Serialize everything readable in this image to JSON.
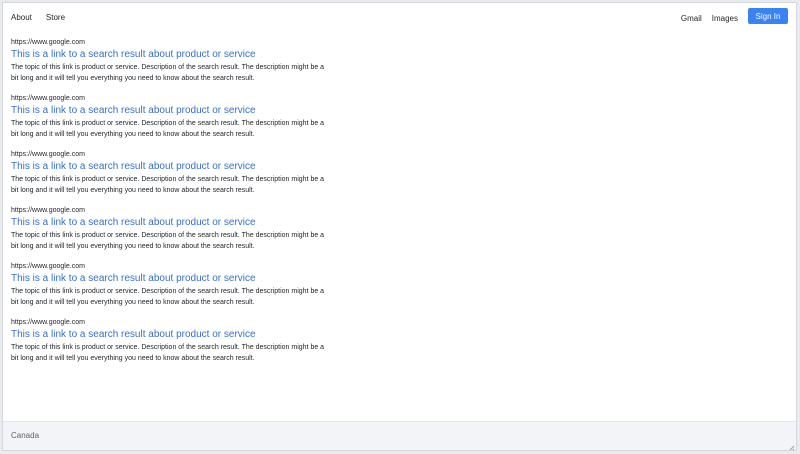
{
  "nav": {
    "left": [
      {
        "label": "About"
      },
      {
        "label": "Store"
      }
    ],
    "right": {
      "gmail": "Gmail",
      "images": "Images",
      "signin": "Sign In"
    }
  },
  "results": [
    {
      "url": "https://www.google.com",
      "title": "This is a link to a search result about product or service",
      "description": "The topic of this link is product or service. Description of the search result. The description might be a bit long and it will tell you everything you need to know about the search result."
    },
    {
      "url": "https://www.google.com",
      "title": "This is a link to a search result about product or service",
      "description": "The topic of this link is product or service. Description of the search result. The description might be a bit long and it will tell you everything you need to know about the search result."
    },
    {
      "url": "https://www.google.com",
      "title": "This is a link to a search result about product or service",
      "description": "The topic of this link is product or service. Description of the search result. The description might be a bit long and it will tell you everything you need to know about the search result."
    },
    {
      "url": "https://www.google.com",
      "title": "This is a link to a search result about product or service",
      "description": "The topic of this link is product or service. Description of the search result. The description might be a bit long and it will tell you everything you need to know about the search result."
    },
    {
      "url": "https://www.google.com",
      "title": "This is a link to a search result about product or service",
      "description": "The topic of this link is product or service. Description of the search result. The description might be a bit long and it will tell you everything you need to know about the search result."
    },
    {
      "url": "https://www.google.com",
      "title": "This is a link to a search result about product or service",
      "description": "The topic of this link is product or service. Description of the search result. The description might be a bit long and it will tell you everything you need to know about the search result."
    }
  ],
  "footer": {
    "country": "Canada"
  },
  "colors": {
    "accent": "#3b82f6",
    "link": "#3470c9",
    "footer_bg": "#f2f4f7"
  },
  "icons": {
    "resize": "resize-handle-icon"
  }
}
